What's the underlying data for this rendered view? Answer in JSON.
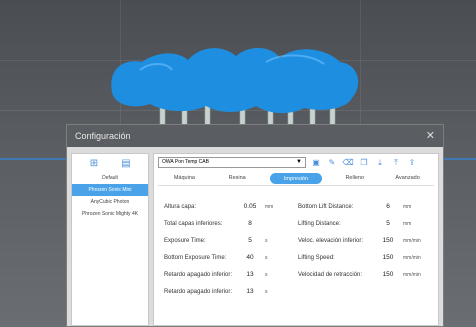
{
  "dialog": {
    "title": "Configuración",
    "close_icon": "close-icon"
  },
  "left_panel": {
    "icons": [
      "import-icon",
      "export-icon"
    ],
    "items": [
      {
        "label": "Default",
        "selected": false
      },
      {
        "label": "Phrozen Sonic Mini",
        "selected": true
      },
      {
        "label": "AnyCubic Photon",
        "selected": false
      },
      {
        "label": "Phrozen Sonic Mighty 4K",
        "selected": false
      }
    ]
  },
  "toolbar": {
    "profile_value": "OWA Pon Temp CAB",
    "icons": [
      "save-icon",
      "edit-icon",
      "delete-icon",
      "copy-icon",
      "import-icon",
      "export-icon",
      "share-icon"
    ]
  },
  "tabs": [
    {
      "label": "Máquina",
      "active": false
    },
    {
      "label": "Resina",
      "active": false
    },
    {
      "label": "Impresión",
      "active": true
    },
    {
      "label": "Relleno",
      "active": false
    },
    {
      "label": "Avanzado",
      "active": false
    }
  ],
  "fields_left": [
    {
      "label": "Altura capa:",
      "value": "0.05",
      "unit": "mm"
    },
    {
      "label": "Total capas inferiores:",
      "value": "8",
      "unit": ""
    },
    {
      "label": "Exposure Time:",
      "value": "5",
      "unit": "s"
    },
    {
      "label": "Bottom Exposure Time:",
      "value": "40",
      "unit": "s"
    },
    {
      "label": "Retardo apagado inferior:",
      "value": "13",
      "unit": "s"
    },
    {
      "label": "Retardo apagado inferior:",
      "value": "13",
      "unit": "s"
    }
  ],
  "fields_right": [
    {
      "label": "Bottom Lift Distance:",
      "value": "6",
      "unit": "mm"
    },
    {
      "label": "Lifting Distance:",
      "value": "5",
      "unit": "mm"
    },
    {
      "label": "Veloc. elevación inferior:",
      "value": "150",
      "unit": "mm/min"
    },
    {
      "label": "Lifting Speed:",
      "value": "150",
      "unit": "mm/min"
    },
    {
      "label": "Velocidad de retracción:",
      "value": "150",
      "unit": "mm/min"
    }
  ],
  "colors": {
    "accent": "#4aa3e8",
    "model": "#1e8fe0",
    "supports": "#c8d2cf"
  }
}
